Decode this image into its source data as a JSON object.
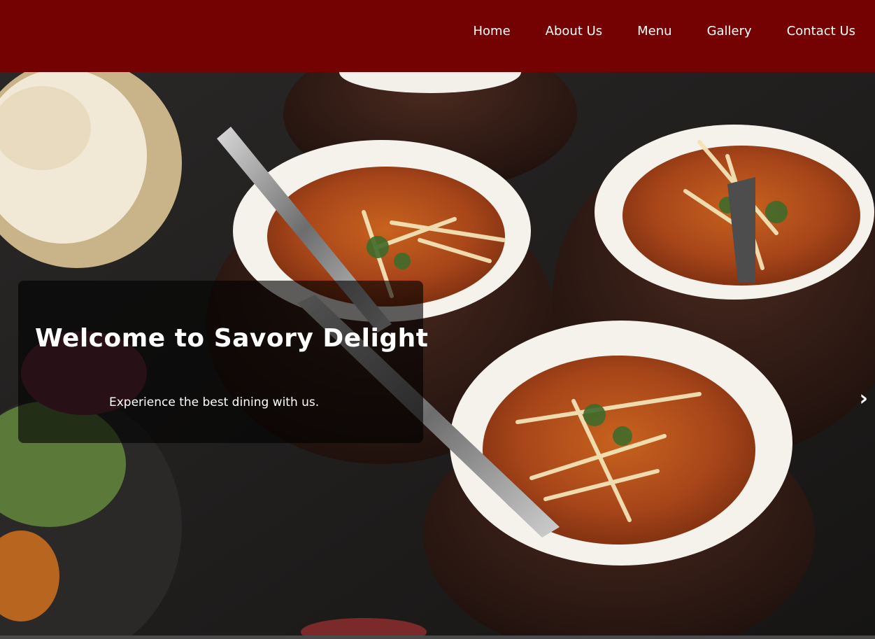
{
  "nav": {
    "items": [
      {
        "label": "Home"
      },
      {
        "label": "About Us"
      },
      {
        "label": "Menu"
      },
      {
        "label": "Gallery"
      },
      {
        "label": "Contact Us"
      }
    ],
    "background_color": "#750202"
  },
  "hero": {
    "title": "Welcome to Savory Delight",
    "subtitle": "Experience the best dining with us.",
    "next_arrow": "›",
    "image_subject": "bowls of curry garnished with ginger and cilantro on a dark table"
  }
}
